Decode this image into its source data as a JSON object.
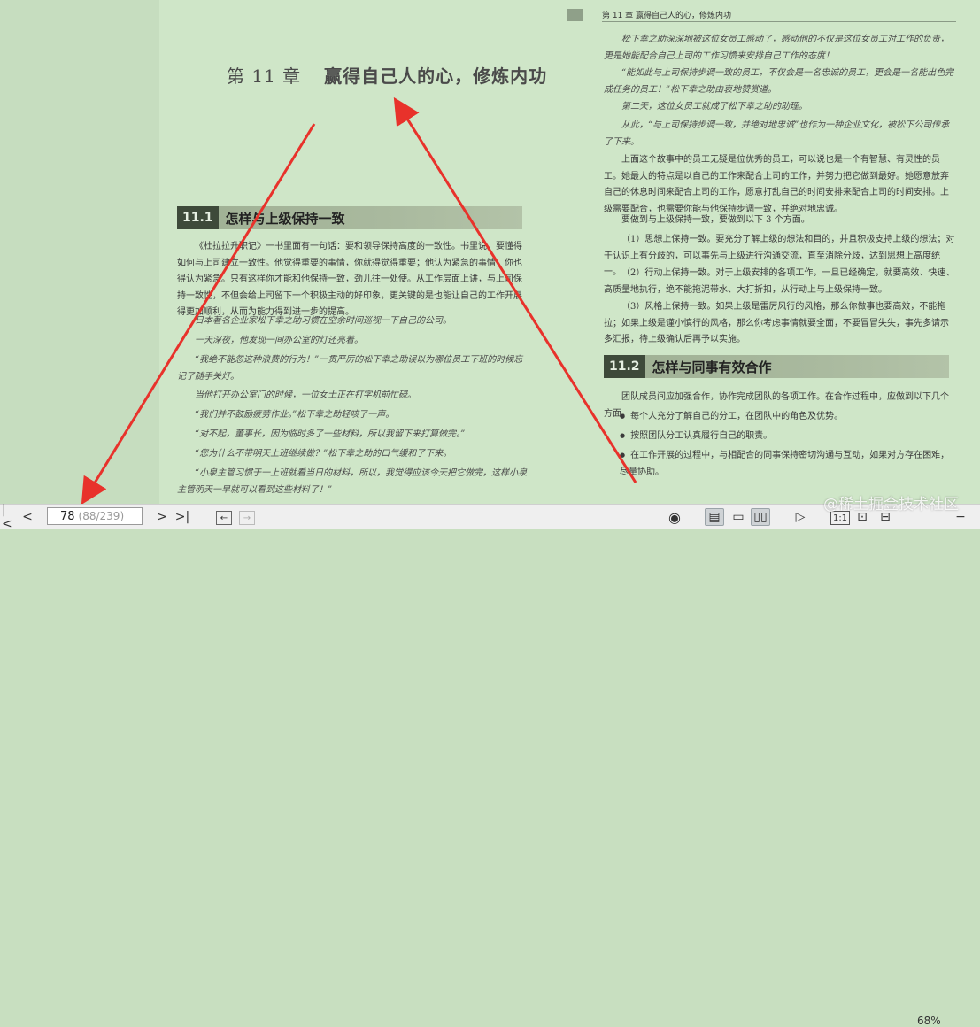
{
  "left_page": {
    "chapter_number": "第 11 章",
    "chapter_title": "赢得自己人的心，修炼内功",
    "section": {
      "number": "11.1",
      "title": "怎样与上级保持一致"
    },
    "paragraphs": [
      "《杜拉拉升职记》一书里面有一句话：要和领导保持高度的一致性。书里说，要懂得如何与上司建立一致性。他觉得重要的事情，你就得觉得重要；他认为紧急的事情，你也得认为紧急。只有这样你才能和他保持一致，劲儿往一处使。从工作层面上讲，与上司保持一致性，不但会给上司留下一个积极主动的好印象，更关键的是也能让自己的工作开展得更加顺利，从而为能力得到进一步的提高。"
    ],
    "story": [
      "日本著名企业家松下幸之助习惯在空余时间巡视一下自己的公司。",
      "一天深夜，他发现一间办公室的灯还亮着。",
      "“我绝不能忽这种浪费的行为！”一贯严厉的松下幸之助误以为哪位员工下班的时候忘记了随手关灯。",
      "当他打开办公室门的时候，一位女士正在打字机前忙碌。",
      "“我们并不鼓励疲劳作业。”松下幸之助轻咳了一声。",
      "“对不起，董事长，因为临时多了一些材料，所以我留下来打算做完。”",
      "“您为什么不带明天上班继续做？”松下幸之助的口气缓和了下来。",
      "“小泉主管习惯于一上班就看当日的材料，所以，我觉得应该今天把它做完，这样小泉主管明天一早就可以看到这些材料了！”"
    ]
  },
  "right_page": {
    "running_head": "第 11 章   赢得自己人的心，修炼内功",
    "story": [
      "松下幸之助深深地被这位女员工感动了，感动他的不仅是这位女员工对工作的负责，更是她能配合自己上司的工作习惯来安排自己工作的态度！",
      "“能如此与上司保持步调一致的员工，不仅会是一名忠诚的员工，更会是一名能出色完成任务的员工！”松下幸之助由衷地赞赏道。",
      "第二天，这位女员工就成了松下幸之助的助理。",
      "从此，“与上司保持步调一致，并绝对地忠诚”也作为一种企业文化，被松下公司传承了下来。"
    ],
    "paragraphs": [
      "上面这个故事中的员工无疑是位优秀的员工，可以说也是一个有智慧、有灵性的员工。她最大的特点是以自己的工作来配合上司的工作，并努力把它做到最好。她愿意放弃自己的休息时间来配合上司的工作，愿意打乱自己的时间安排来配合上司的时间安排。上级需要配合，也需要你能与他保持步调一致，并绝对地忠诚。",
      "要做到与上级保持一致，要做到以下 3 个方面。",
      "（1）思想上保持一致。要充分了解上级的想法和目的，并且积极支持上级的想法；对于认识上有分歧的，可以事先与上级进行沟通交流，直至消除分歧，达到思想上高度统一。",
      "（2）行动上保持一致。对于上级安排的各项工作，一旦已经确定，就要高效、快速、高质量地执行，绝不能拖泥带水、大打折扣，从行动上与上级保持一致。",
      "（3）风格上保持一致。如果上级是雷厉风行的风格，那么你做事也要高效，不能拖拉；如果上级是谨小慎行的风格，那么你考虑事情就要全面，不要冒冒失失，事先多请示多汇报，待上级确认后再予以实施。"
    ],
    "section": {
      "number": "11.2",
      "title": "怎样与同事有效合作"
    },
    "section_intro": "团队成员间应加强合作，协作完成团队的各项工作。在合作过程中，应做到以下几个方面。",
    "bullets": [
      "每个人充分了解自己的分工，在团队中的角色及优势。",
      "按照团队分工认真履行自己的职责。",
      "在工作开展的过程中，与相配合的同事保持密切沟通与互动，如果对方存在困难，尽量协助。"
    ]
  },
  "toolbar": {
    "current_page": "78",
    "page_info": "(88/239)",
    "zoom": "68%",
    "icons": [
      "first-page-icon",
      "prev-page-icon",
      "next-page-icon",
      "last-page-icon",
      "back-icon",
      "forward-icon",
      "eye-icon",
      "single-page-icon",
      "page-icon",
      "double-page-icon",
      "play-icon",
      "actual-size-icon",
      "fit-page-icon",
      "fit-width-icon"
    ]
  },
  "watermark": "@稀土掘金技术社区",
  "colors": {
    "page_bg": "#cfe6c8",
    "arrow": "#e8322b",
    "section_dark": "#3e4a3a"
  }
}
